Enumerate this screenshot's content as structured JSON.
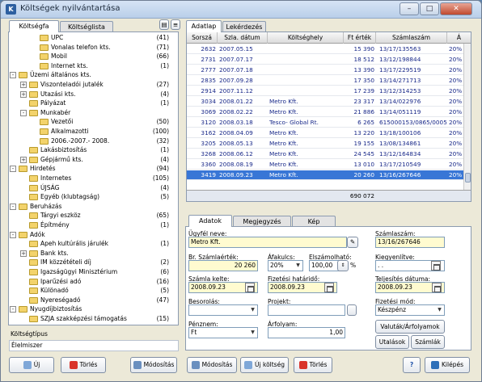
{
  "window": {
    "title": "Költségek nyilvántartása",
    "icon": "app-icon",
    "minimize": "–",
    "maximize": "□",
    "close": "✕"
  },
  "left": {
    "tabs": [
      "Költségfa",
      "Költséglista"
    ],
    "tree": [
      {
        "label": "UPC",
        "count": "(41)",
        "level": 2
      },
      {
        "label": "Vonalas telefon kts.",
        "count": "(71)",
        "level": 2
      },
      {
        "label": "Mobil",
        "count": "(66)",
        "level": 2
      },
      {
        "label": "Internet kts.",
        "count": "(1)",
        "level": 2
      },
      {
        "label": "Üzemi általános kts.",
        "count": "",
        "level": 0,
        "exp": "-"
      },
      {
        "label": "Viszonteladói jutalék",
        "count": "(27)",
        "level": 1,
        "exp": "+"
      },
      {
        "label": "Utazási kts.",
        "count": "(4)",
        "level": 1,
        "exp": "+"
      },
      {
        "label": "Pályázat",
        "count": "(1)",
        "level": 1
      },
      {
        "label": "Munkabér",
        "count": "",
        "level": 1,
        "exp": "-"
      },
      {
        "label": "Vezetői",
        "count": "(50)",
        "level": 2
      },
      {
        "label": "Alkalmazotti",
        "count": "(100)",
        "level": 2
      },
      {
        "label": "2006.-2007.- 2008.",
        "count": "(32)",
        "level": 2
      },
      {
        "label": "Lakásbiztosítás",
        "count": "(1)",
        "level": 1
      },
      {
        "label": "Gépjármű kts.",
        "count": "(4)",
        "level": 1,
        "exp": "+"
      },
      {
        "label": "Hirdetés",
        "count": "(94)",
        "level": 0,
        "exp": "-"
      },
      {
        "label": "Internetes",
        "count": "(105)",
        "level": 1
      },
      {
        "label": "ÚJSÁG",
        "count": "(4)",
        "level": 1
      },
      {
        "label": "Egyéb (klubtagság)",
        "count": "(5)",
        "level": 1
      },
      {
        "label": "Beruházás",
        "count": "",
        "level": 0,
        "exp": "-"
      },
      {
        "label": "Tárgyi eszköz",
        "count": "(65)",
        "level": 1
      },
      {
        "label": "Építmény",
        "count": "(1)",
        "level": 1
      },
      {
        "label": "Adók",
        "count": "",
        "level": 0,
        "exp": "-"
      },
      {
        "label": "Apeh kultúrális járulék",
        "count": "(1)",
        "level": 1
      },
      {
        "label": "Bank kts.",
        "count": "",
        "level": 1,
        "exp": "+"
      },
      {
        "label": "IM közzétételi díj",
        "count": "(2)",
        "level": 1
      },
      {
        "label": "Igazságügyi Minisztérium",
        "count": "(6)",
        "level": 1
      },
      {
        "label": "Iparűzési adó",
        "count": "(16)",
        "level": 1
      },
      {
        "label": "Különadó",
        "count": "(5)",
        "level": 1
      },
      {
        "label": "Nyereségadó",
        "count": "(47)",
        "level": 1
      },
      {
        "label": "Nyugdíjbiztosítás",
        "count": "",
        "level": 0,
        "exp": "-"
      },
      {
        "label": "SZJA szakképzési támogatás",
        "count": "(15)",
        "level": 1
      }
    ],
    "type_label": "Költségtípus",
    "type_value": "Élelmiszer",
    "buttons": {
      "new": "Új",
      "delete": "Törlés",
      "modify": "Módosítás"
    }
  },
  "right": {
    "tabs": [
      "Adatlap",
      "Lekérdezés"
    ],
    "grid": {
      "headers": [
        "Sorszá",
        "Szla. dátum",
        "Költséghely",
        "Ft érték",
        "Számlaszám",
        "Á"
      ],
      "rows": [
        [
          "2632",
          "2007.05.15",
          "",
          "15 390",
          "13/17/135563",
          "20%"
        ],
        [
          "2731",
          "2007.07.17",
          "",
          "18 512",
          "13/12/198844",
          "20%"
        ],
        [
          "2777",
          "2007.07.18",
          "",
          "13 390",
          "13/17/229519",
          "20%"
        ],
        [
          "2835",
          "2007.09.28",
          "",
          "17 350",
          "13/14/271713",
          "20%"
        ],
        [
          "2914",
          "2007.11.12",
          "",
          "17 239",
          "13/12/314253",
          "20%"
        ],
        [
          "3034",
          "2008.01.22",
          "Metro Kft.",
          "23 317",
          "13/14/022976",
          "20%"
        ],
        [
          "3069",
          "2008.02.22",
          "Metro Kft.",
          "21 886",
          "13/14/051119",
          "20%"
        ],
        [
          "3120",
          "2008.03.18",
          "Tesco- Global Rt.",
          "6 265",
          "615000153/0865/00054",
          "20%"
        ],
        [
          "3162",
          "2008.04.09",
          "Metro Kft.",
          "13 220",
          "13/18/100106",
          "20%"
        ],
        [
          "3205",
          "2008.05.13",
          "Metro Kft.",
          "19 155",
          "13/08/134861",
          "20%"
        ],
        [
          "3268",
          "2008.06.12",
          "Metro Kft.",
          "24 545",
          "13/12/164834",
          "20%"
        ],
        [
          "3360",
          "2008.08.19",
          "Metro Kft.",
          "13 010",
          "13/17/210549",
          "20%"
        ],
        [
          "3419",
          "2008.09.23",
          "Metro Kft.",
          "20 260",
          "13/16/267646",
          "20%"
        ]
      ],
      "selected_row": 12,
      "total": "690 072"
    },
    "form_tabs": [
      "Adatok",
      "Megjegyzés",
      "Kép"
    ],
    "form": {
      "partner_label": "Ügyfél neve:",
      "partner_value": "Metro Kft.",
      "invoice_no_label": "Számlaszám:",
      "invoice_no_value": "13/16/267646",
      "gross_label": "Br. Számlaérték:",
      "gross_value": "20 260",
      "vat_label": "Áfakulcs:",
      "vat_value": "20%",
      "deductible_label": "Elszámolható:",
      "deductible_value": "100,00",
      "percent_sign": "%",
      "settled_label": "Kiegyenlítve:",
      "settled_value": ". .",
      "invoice_date_label": "Számla kelte:",
      "invoice_date_value": "2008.09.23",
      "due_label": "Fizetési határidő:",
      "due_value": "2008.09.23",
      "fulfil_label": "Teljesítés dátuma:",
      "fulfil_value": "2008.09.23",
      "class_label": "Besorolás:",
      "class_value": "",
      "project_label": "Projekt:",
      "project_value": "",
      "paymode_label": "Fizetési mód:",
      "paymode_value": "Készpénz",
      "currency_label": "Pénznem:",
      "currency_value": "Ft",
      "rate_label": "Árfolyam:",
      "rate_value": "1,00",
      "currency_btn": "Valuták/Árfolyamok",
      "transfers_btn": "Utalások",
      "accounts_btn": "Számlák"
    },
    "buttons": {
      "modify": "Módosítás",
      "new_cost": "Új költség",
      "delete": "Törlés",
      "help": "?",
      "exit": "Kilépés"
    }
  },
  "colors": {
    "selection": "#3876d6",
    "link_text": "#1a2a8a",
    "required_field": "#fffbd0"
  }
}
